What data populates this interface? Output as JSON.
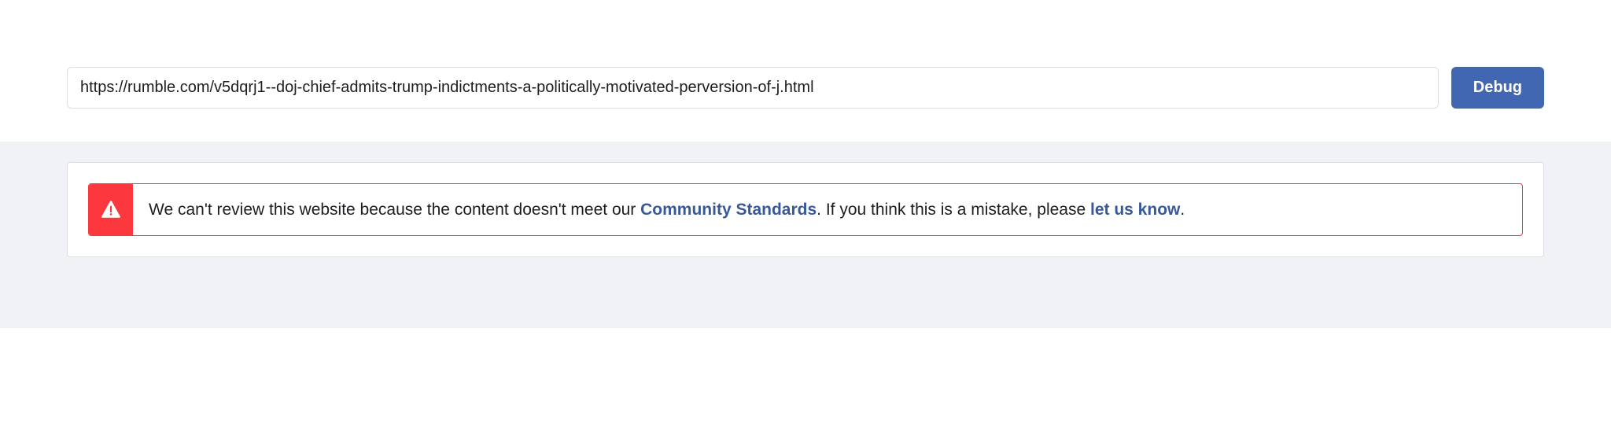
{
  "input": {
    "url_value": "https://rumble.com/v5dqrj1--doj-chief-admits-trump-indictments-a-politically-motivated-perversion-of-j.html"
  },
  "button": {
    "debug_label": "Debug"
  },
  "alert": {
    "text_before_link1": "We can't review this website because the content doesn't meet our ",
    "link1_label": "Community Standards",
    "text_middle": ". If you think this is a mistake, please ",
    "link2_label": "let us know",
    "text_after": "."
  }
}
